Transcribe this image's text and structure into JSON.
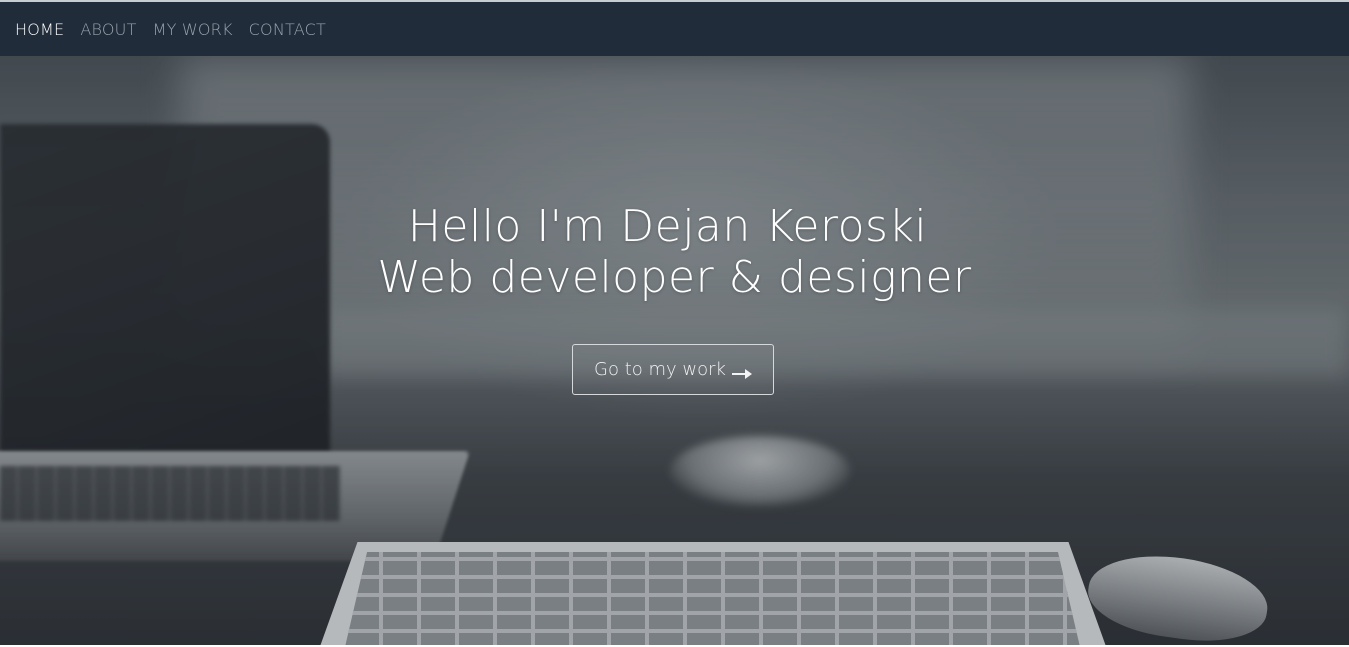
{
  "nav": {
    "items": [
      {
        "label": "HOME",
        "active": true
      },
      {
        "label": "ABOUT",
        "active": false
      },
      {
        "label": "MY WORK",
        "active": false
      },
      {
        "label": "CONTACT",
        "active": false
      }
    ]
  },
  "hero": {
    "line1": "Hello I'm Dejan Keroski",
    "line2": "Web developer & designer",
    "cta_label": "Go to my work",
    "cta_icon": "arrow-right-icon"
  },
  "colors": {
    "navbar_bg": "#202c3a",
    "nav_text": "#9aa3ad",
    "nav_active": "#ffffff",
    "hero_text": "#ffffff"
  }
}
